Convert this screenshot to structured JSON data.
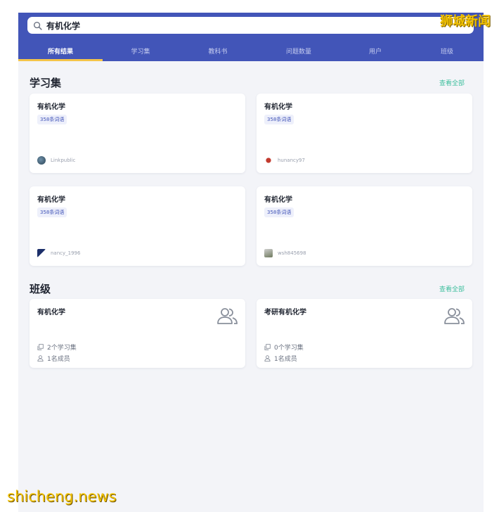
{
  "search": {
    "value": "有机化学"
  },
  "tabs": [
    {
      "label": "所有结果"
    },
    {
      "label": "学习集"
    },
    {
      "label": "教科书"
    },
    {
      "label": "问题数量"
    },
    {
      "label": "用户"
    },
    {
      "label": "班级"
    }
  ],
  "study_sets": {
    "title": "学习集",
    "see_all": "查看全部",
    "cards": [
      {
        "title": "有机化学",
        "terms": "358条词语",
        "author": "Linkpublic"
      },
      {
        "title": "有机化学",
        "terms": "358条词语",
        "author": "hunancy97"
      },
      {
        "title": "有机化学",
        "terms": "358条词语",
        "author": "nancy_1996"
      },
      {
        "title": "有机化学",
        "terms": "358条词语",
        "author": "wsh845698"
      }
    ]
  },
  "classes": {
    "title": "班级",
    "see_all": "查看全部",
    "cards": [
      {
        "title": "有机化学",
        "sets": "2个学习集",
        "members": "1名成员"
      },
      {
        "title": "考研有机化学",
        "sets": "0个学习集",
        "members": "1名成员"
      }
    ]
  },
  "watermarks": {
    "top": "狮城新闻",
    "bottom": "shicheng.news"
  },
  "colors": {
    "header": "#4255b8",
    "accent": "#3fbf9e",
    "tab_indicator": "#f4c44a"
  }
}
